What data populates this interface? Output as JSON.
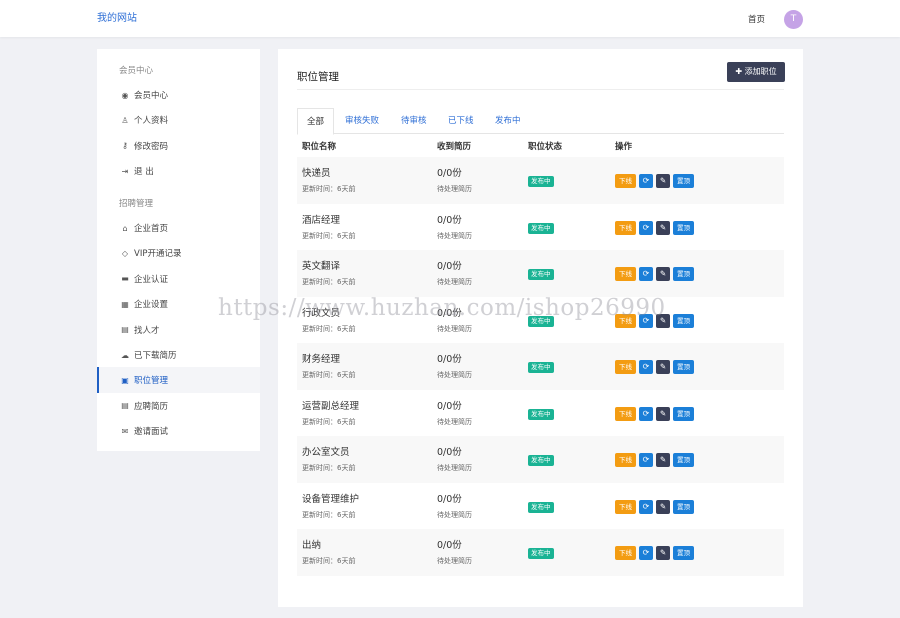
{
  "header": {
    "logo": "我的网站",
    "home": "首页",
    "avatar_letter": "T"
  },
  "sidebar": {
    "member_heading": "会员中心",
    "member_items": [
      {
        "label": "会员中心",
        "icon": "user-circle-icon",
        "glyph": "◉"
      },
      {
        "label": "个人资料",
        "icon": "user-icon",
        "glyph": "♙"
      },
      {
        "label": "修改密码",
        "icon": "key-icon",
        "glyph": "⚷"
      },
      {
        "label": "退 出",
        "icon": "sign-out-icon",
        "glyph": "⇥"
      }
    ],
    "recruit_heading": "招聘管理",
    "recruit_items": [
      {
        "label": "企业首页",
        "icon": "home-icon",
        "glyph": "⌂"
      },
      {
        "label": "VIP开通记录",
        "icon": "diamond-icon",
        "glyph": "◇"
      },
      {
        "label": "企业认证",
        "icon": "id-card-icon",
        "glyph": "▬"
      },
      {
        "label": "企业设置",
        "icon": "building-icon",
        "glyph": "▦"
      },
      {
        "label": "找人才",
        "icon": "address-card-icon",
        "glyph": "▤"
      },
      {
        "label": "已下载简历",
        "icon": "cloud-download-icon",
        "glyph": "☁"
      },
      {
        "label": "职位管理",
        "icon": "briefcase-icon",
        "glyph": "▣",
        "active": true
      },
      {
        "label": "应聘简历",
        "icon": "vcard-icon",
        "glyph": "▤"
      },
      {
        "label": "邀请面试",
        "icon": "envelope-open-icon",
        "glyph": "✉"
      }
    ]
  },
  "main": {
    "title": "职位管理",
    "add_button": "添加职位",
    "tabs": [
      "全部",
      "审核失败",
      "待审核",
      "已下线",
      "发布中"
    ],
    "columns": [
      "职位名称",
      "收到简历",
      "职位状态",
      "操作"
    ],
    "rows": [
      {
        "name": "快递员",
        "updated": "更新时间：6天前",
        "count": "0/0份",
        "pending": "待处理简历",
        "status": "发布中"
      },
      {
        "name": "酒店经理",
        "updated": "更新时间：6天前",
        "count": "0/0份",
        "pending": "待处理简历",
        "status": "发布中"
      },
      {
        "name": "英文翻译",
        "updated": "更新时间：6天前",
        "count": "0/0份",
        "pending": "待处理简历",
        "status": "发布中"
      },
      {
        "name": "行政文员",
        "updated": "更新时间：6天前",
        "count": "0/0份",
        "pending": "待处理简历",
        "status": "发布中"
      },
      {
        "name": "财务经理",
        "updated": "更新时间：6天前",
        "count": "0/0份",
        "pending": "待处理简历",
        "status": "发布中"
      },
      {
        "name": "运营副总经理",
        "updated": "更新时间：6天前",
        "count": "0/0份",
        "pending": "待处理简历",
        "status": "发布中"
      },
      {
        "name": "办公室文员",
        "updated": "更新时间：6天前",
        "count": "0/0份",
        "pending": "待处理简历",
        "status": "发布中"
      },
      {
        "name": "设备管理维护",
        "updated": "更新时间：6天前",
        "count": "0/0份",
        "pending": "待处理简历",
        "status": "发布中"
      },
      {
        "name": "出纳",
        "updated": "更新时间：6天前",
        "count": "0/0份",
        "pending": "待处理简历",
        "status": "发布中"
      }
    ],
    "actions": {
      "offline": "下线",
      "refresh_icon": "refresh-icon",
      "edit_icon": "edit-icon",
      "top": "置顶"
    }
  },
  "watermark": "https://www.huzhan.com/ishop26990",
  "colors": {
    "accent": "#1f5fc4",
    "badge": "#1ab394",
    "offline": "#f39c12",
    "dark": "#3a4058",
    "blue": "#1b7fd8"
  }
}
